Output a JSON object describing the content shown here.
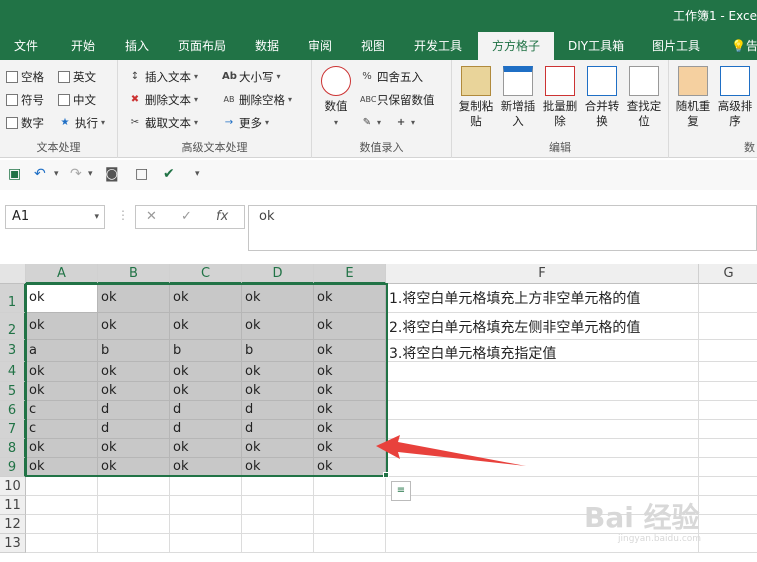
{
  "window": {
    "title": "工作簿1 - Exce"
  },
  "tabs": [
    "文件",
    "开始",
    "插入",
    "页面布局",
    "数据",
    "审阅",
    "视图",
    "开发工具",
    "方方格子",
    "DIY工具箱",
    "图片工具",
    "告"
  ],
  "ribbon": {
    "text_processing": {
      "label": "文本处理",
      "checkboxes": [
        "空格",
        "英文",
        "符号",
        "中文",
        "数字"
      ],
      "exec": "执行"
    },
    "advanced_text": {
      "label": "高级文本处理",
      "items": [
        "插入文本",
        "删除文本",
        "截取文本",
        "大小写",
        "删除空格",
        "更多"
      ]
    },
    "numeric_entry": {
      "label": "数值录入",
      "number": "数值",
      "round": "四舍五入",
      "keep_values": "只保留数值"
    },
    "edit": {
      "label": "编辑",
      "buttons": [
        "复制粘贴",
        "新增插入",
        "批量删除",
        "合并转换",
        "查找定位"
      ]
    },
    "more": {
      "label": "数",
      "buttons": [
        "随机重复",
        "高级排序"
      ]
    }
  },
  "formula_bar": {
    "name_box": "A1",
    "formula": "ok"
  },
  "sheet": {
    "columns": [
      "A",
      "B",
      "C",
      "D",
      "E",
      "F",
      "G"
    ],
    "rows": [
      "1",
      "2",
      "3",
      "4",
      "5",
      "6",
      "7",
      "8",
      "9",
      "10",
      "11",
      "12",
      "13"
    ],
    "cells": [
      [
        "ok",
        "ok",
        "ok",
        "ok",
        "ok"
      ],
      [
        "ok",
        "ok",
        "ok",
        "ok",
        "ok"
      ],
      [
        "a",
        "b",
        "b",
        "b",
        "ok"
      ],
      [
        "ok",
        "ok",
        "ok",
        "ok",
        "ok"
      ],
      [
        "ok",
        "ok",
        "ok",
        "ok",
        "ok"
      ],
      [
        "c",
        "d",
        "d",
        "d",
        "ok"
      ],
      [
        "c",
        "d",
        "d",
        "d",
        "ok"
      ],
      [
        "ok",
        "ok",
        "ok",
        "ok",
        "ok"
      ],
      [
        "ok",
        "ok",
        "ok",
        "ok",
        "ok"
      ]
    ],
    "notes": [
      "1.将空白单元格填充上方非空单元格的值",
      "2.将空白单元格填充左侧非空单元格的值",
      "3.将空白单元格填充指定值"
    ]
  },
  "watermark": {
    "main": "Bai 经验",
    "sub": "jingyan.baidu.com"
  },
  "colors": {
    "accent": "#217346",
    "arrow": "#e8413c"
  }
}
